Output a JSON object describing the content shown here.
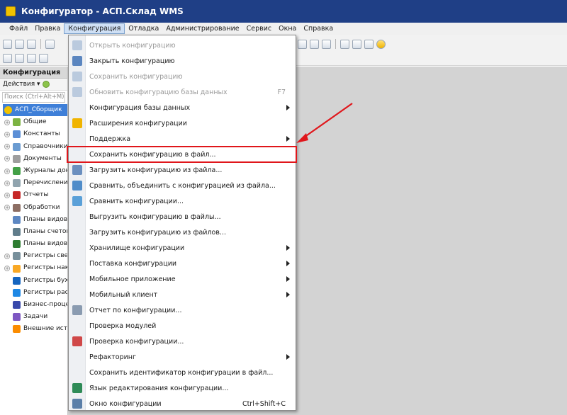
{
  "window": {
    "title": "Конфигуратор - АСП.Склад WMS"
  },
  "menubar": {
    "items": [
      "Файл",
      "Правка",
      "Конфигурация",
      "Отладка",
      "Администрирование",
      "Сервис",
      "Окна",
      "Справка"
    ],
    "active_index": 2
  },
  "left_panel": {
    "header": "Конфигурация",
    "actions_label": "Действия ▾",
    "search_placeholder": "Поиск (Ctrl+Alt+M)",
    "tree": [
      {
        "label": "АСП_Сборщик",
        "icon": "config-root-icon",
        "expandable": false,
        "root": true
      },
      {
        "label": "Общие",
        "icon": "common-icon",
        "expandable": true
      },
      {
        "label": "Константы",
        "icon": "constants-icon",
        "expandable": true
      },
      {
        "label": "Справочники",
        "icon": "catalogs-icon",
        "expandable": true
      },
      {
        "label": "Документы",
        "icon": "documents-icon",
        "expandable": true
      },
      {
        "label": "Журналы документов",
        "icon": "journals-icon",
        "expandable": true
      },
      {
        "label": "Перечисления",
        "icon": "enums-icon",
        "expandable": true
      },
      {
        "label": "Отчеты",
        "icon": "reports-icon",
        "expandable": true
      },
      {
        "label": "Обработки",
        "icon": "processing-icon",
        "expandable": true
      },
      {
        "label": "Планы видов характеристик",
        "icon": "chart-of-characteristics-icon",
        "expandable": false
      },
      {
        "label": "Планы счетов",
        "icon": "chart-of-accounts-icon",
        "expandable": false
      },
      {
        "label": "Планы видов расчета",
        "icon": "chart-of-calculation-icon",
        "expandable": false
      },
      {
        "label": "Регистры сведений",
        "icon": "info-registers-icon",
        "expandable": true
      },
      {
        "label": "Регистры накопления",
        "icon": "accumulation-registers-icon",
        "expandable": true
      },
      {
        "label": "Регистры бухгалтерии",
        "icon": "accounting-registers-icon",
        "expandable": false
      },
      {
        "label": "Регистры расчета",
        "icon": "calculation-registers-icon",
        "expandable": false
      },
      {
        "label": "Бизнес-процессы",
        "icon": "business-process-icon",
        "expandable": false
      },
      {
        "label": "Задачи",
        "icon": "tasks-icon",
        "expandable": false
      },
      {
        "label": "Внешние источники",
        "icon": "external-sources-icon",
        "expandable": false
      }
    ]
  },
  "config_menu": {
    "items": [
      {
        "label": "Открыть конфигурацию",
        "disabled": true,
        "icon": "open-config-icon"
      },
      {
        "label": "Закрыть конфигурацию",
        "disabled": false,
        "icon": "close-config-icon"
      },
      {
        "label": "Сохранить конфигурацию",
        "disabled": true,
        "icon": "save-config-icon"
      },
      {
        "label": "Обновить конфигурацию базы данных",
        "disabled": true,
        "shortcut": "F7",
        "icon": "update-db-config-icon"
      },
      {
        "label": "Конфигурация базы данных",
        "submenu": true
      },
      {
        "label": "Расширения конфигурации",
        "icon": "extensions-icon"
      },
      {
        "label": "Поддержка",
        "submenu": true
      },
      {
        "label": "Сохранить конфигурацию в файл..."
      },
      {
        "label": "Загрузить конфигурацию из файла...",
        "icon": "load-from-file-icon"
      },
      {
        "label": "Сравнить, объединить с конфигурацией из файла...",
        "icon": "compare-merge-file-icon"
      },
      {
        "label": "Сравнить конфигурации...",
        "icon": "compare-configs-icon"
      },
      {
        "label": "Выгрузить конфигурацию в файлы..."
      },
      {
        "label": "Загрузить конфигурацию из файлов..."
      },
      {
        "label": "Хранилище конфигурации",
        "submenu": true
      },
      {
        "label": "Поставка конфигурации",
        "submenu": true
      },
      {
        "label": "Мобильное приложение",
        "submenu": true
      },
      {
        "label": "Мобильный клиент",
        "submenu": true
      },
      {
        "label": "Отчет по конфигурации...",
        "icon": "config-report-icon"
      },
      {
        "label": "Проверка модулей"
      },
      {
        "label": "Проверка конфигурации...",
        "icon": "check-config-icon"
      },
      {
        "label": "Рефакторинг",
        "submenu": true
      },
      {
        "label": "Сохранить идентификатор конфигурации в файл..."
      },
      {
        "label": "Язык редактирования конфигурации...",
        "icon": "edit-language-icon"
      },
      {
        "label": "Окно конфигурации",
        "shortcut": "Ctrl+Shift+C",
        "icon": "config-window-icon"
      }
    ],
    "highlighted_index": 7
  },
  "colors": {
    "titlebar": "#1f3f86",
    "highlight_box": "#e0161b",
    "arrow": "#e0161b",
    "tree_selection": "#3e7fd8"
  }
}
